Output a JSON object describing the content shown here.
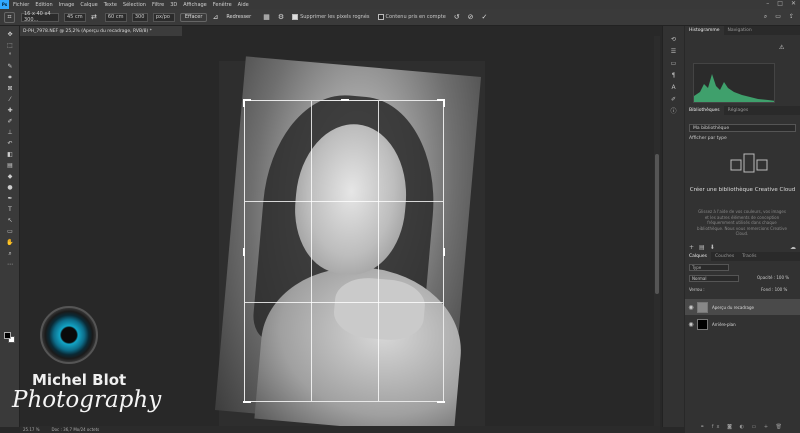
{
  "menu": [
    "Fichier",
    "Edition",
    "Image",
    "Calque",
    "Texte",
    "Sélection",
    "Filtre",
    "3D",
    "Affichage",
    "Fenêtre",
    "Aide"
  ],
  "options": {
    "ratio_value": "16 x 40 x4 300...",
    "width_value": "45 cm",
    "height_value": "60 cm",
    "resolution_value": "300",
    "resolution_unit": "px/po",
    "clear_label": "Effacer",
    "straighten_label": "Redresser",
    "delete_cropped_label": "Supprimer les pixels rognés",
    "content_aware_label": "Contenu pris en compte"
  },
  "document": {
    "tab_title": "D-PH_7978.NEF @ 25,2% (Aperçu du recadrage, RVB/8) *"
  },
  "status": {
    "zoom": "25.17 %",
    "doc_size": "Doc : 36,7 Mo/24 octets"
  },
  "watermark": {
    "name": "Michel Blot",
    "subtitle": "Photography"
  },
  "panels": {
    "histogram_tabs": [
      "Histogramme",
      "Navigation"
    ],
    "library_tabs": [
      "Bibliothèques",
      "Réglages"
    ],
    "library_select": "Ma bibliothèque",
    "library_view": "Afficher par type",
    "library_title": "Créer une bibliothèque Creative Cloud",
    "library_desc": "Glissez à l'aide de vos couleurs, vos images et les autres éléments de conception fréquemment utilisés dans chaque bibliothèque. Nous vous remercions Creative Cloud.",
    "layer_tabs": [
      "Calques",
      "Couches",
      "Tracés"
    ],
    "layer_search": "Type",
    "blend_mode": "Normal",
    "opacity_label": "Opacité : 100 %",
    "lock_label": "Verrou :",
    "fill_label": "Fond : 100 %",
    "layers": [
      {
        "name": "Aperçu du recadrage",
        "selected": true
      },
      {
        "name": "Arrière-plan",
        "selected": false
      }
    ]
  },
  "colors": {
    "accent": "#31a8ff",
    "panel_bg": "#323232",
    "canvas_bg": "#282828",
    "histogram_fill": "#3fa06c"
  }
}
